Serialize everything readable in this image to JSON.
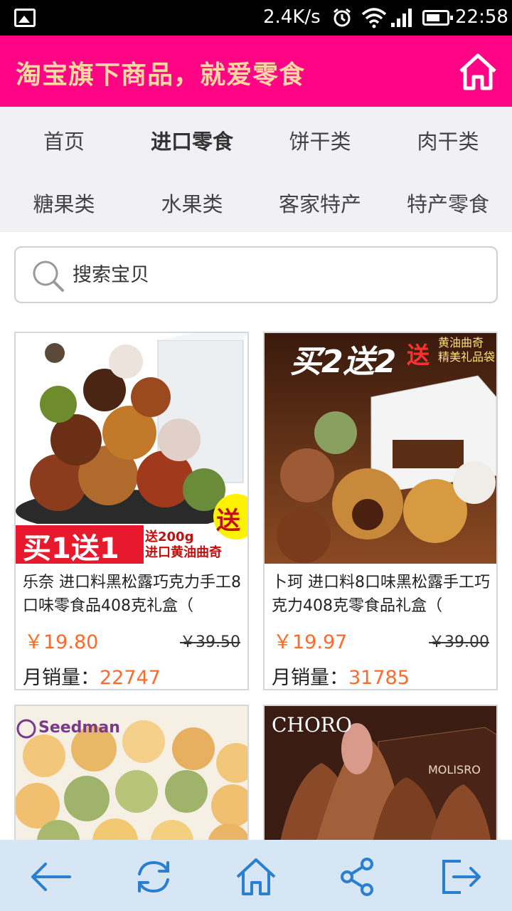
{
  "status": {
    "speed": "2.4K/s",
    "time": "22:58"
  },
  "header": {
    "title": "淘宝旗下商品，就爱零食"
  },
  "nav": {
    "items": [
      {
        "label": "首页",
        "active": false
      },
      {
        "label": "进口零食",
        "active": true
      },
      {
        "label": "饼干类",
        "active": false
      },
      {
        "label": "肉干类",
        "active": false
      },
      {
        "label": "糖果类",
        "active": false
      },
      {
        "label": "水果类",
        "active": false
      },
      {
        "label": "客家特产",
        "active": false
      },
      {
        "label": "特产零食",
        "active": false
      }
    ]
  },
  "search": {
    "placeholder": "搜索宝贝"
  },
  "products": [
    {
      "name": "乐奈 进口料黑松露巧克力手工8口味零食品408克礼盒（",
      "price": "￥19.80",
      "old_price": "￥39.50",
      "sales_label": "月销量：",
      "sales": "22747",
      "promo_main": "买1送1",
      "promo_side": "送200g\n进口黄油曲奇",
      "promo_badge": "送"
    },
    {
      "name": "卜珂 进口料8口味黑松露手工巧克力408克零食品礼盒（",
      "price": "￥19.97",
      "old_price": "￥39.00",
      "sales_label": "月销量：",
      "sales": "31785",
      "promo_main": "买2送2",
      "promo_badge": "送",
      "promo_side": "黄油曲奇\n精美礼品袋"
    },
    {
      "brand": "Seedman"
    },
    {
      "brand": "CHORO",
      "box_label": "MOLISRO"
    }
  ],
  "colors": {
    "header_bg": "#ff0585",
    "header_title": "#ffd8a0",
    "price": "#ff6a2a",
    "toolbar_bg": "#d6e6f5",
    "toolbar_icon": "#2a7fd0"
  },
  "toolbar": {
    "icons": [
      "back-arrow-icon",
      "refresh-icon",
      "home-icon",
      "share-icon",
      "exit-icon"
    ]
  }
}
